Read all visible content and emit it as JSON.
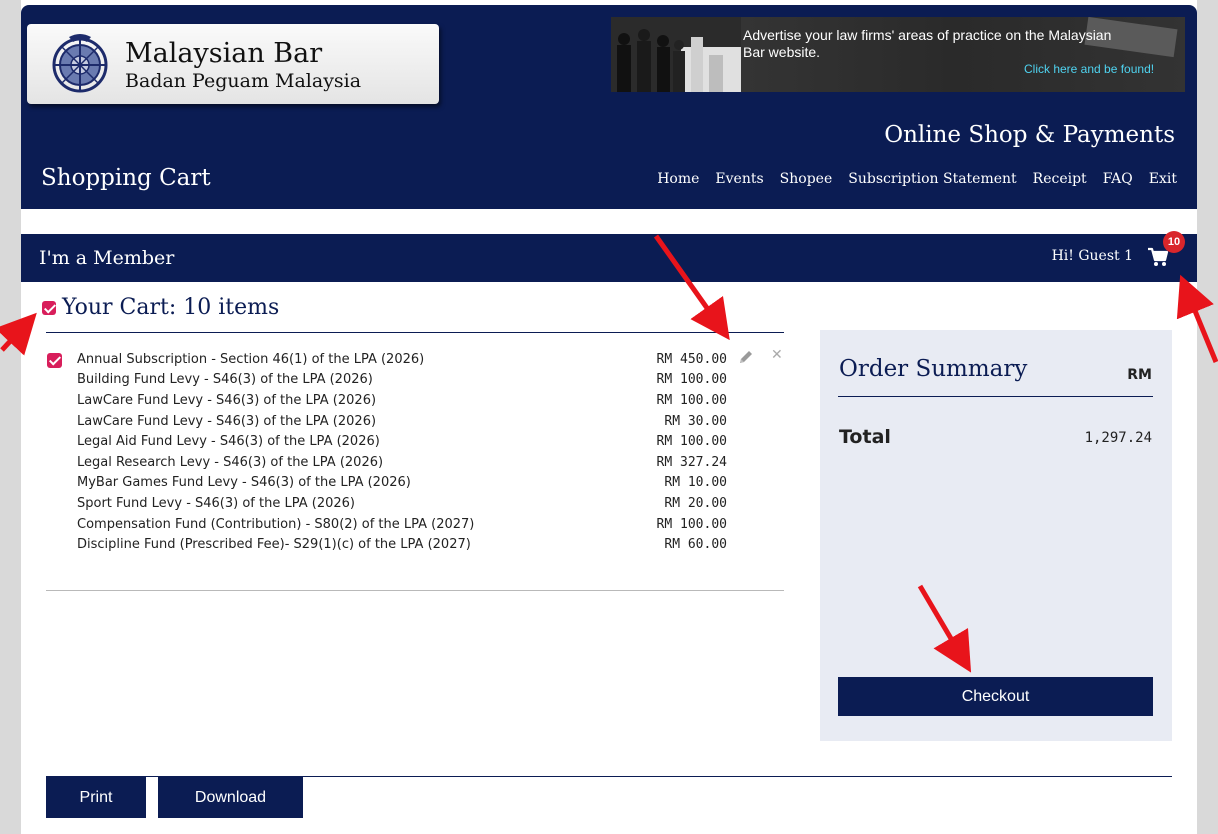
{
  "brand": {
    "title": "Malaysian Bar",
    "subtitle": "Badan Peguam Malaysia"
  },
  "ad": {
    "text": "Advertise your law firms' areas of practice on the Malaysian Bar website.",
    "link": "Click here and be found!"
  },
  "header": {
    "shop_title": "Online Shop & Payments",
    "page_heading": "Shopping Cart",
    "nav": [
      "Home",
      "Events",
      "Shopee",
      "Subscription Statement",
      "Receipt",
      "FAQ",
      "Exit"
    ]
  },
  "member_bar": {
    "title": "I'm a Member",
    "greeting": "Hi! Guest 1",
    "cart_count": "10"
  },
  "cart": {
    "heading": "Your Cart: 10 items",
    "items": [
      {
        "name": "Annual Subscription - Section 46(1) of the LPA (2026)",
        "price": "RM 450.00"
      },
      {
        "name": "Building Fund Levy - S46(3) of the LPA (2026)",
        "price": "RM 100.00"
      },
      {
        "name": "LawCare Fund Levy - S46(3) of the LPA (2026)",
        "price": "RM 100.00"
      },
      {
        "name": "LawCare Fund Levy - S46(3) of the LPA (2026)",
        "price": "RM 30.00"
      },
      {
        "name": "Legal Aid Fund Levy - S46(3) of the LPA (2026)",
        "price": "RM 100.00"
      },
      {
        "name": "Legal Research Levy - S46(3) of the LPA (2026)",
        "price": "RM 327.24"
      },
      {
        "name": "MyBar Games Fund Levy - S46(3) of the LPA (2026)",
        "price": "RM 10.00"
      },
      {
        "name": "Sport Fund Levy - S46(3) of the LPA (2026)",
        "price": "RM 20.00"
      },
      {
        "name": "Compensation Fund (Contribution) - S80(2) of the LPA (2027)",
        "price": "RM 100.00"
      },
      {
        "name": "Discipline Fund (Prescribed Fee)- S29(1)(c) of the LPA (2027)",
        "price": "RM 60.00"
      }
    ],
    "remove_glyph": "✕"
  },
  "summary": {
    "title": "Order Summary",
    "currency": "RM",
    "total_label": "Total",
    "total_value": "1,297.24",
    "checkout_label": "Checkout"
  },
  "actions": {
    "print_label": "Print",
    "download_label": "Download"
  },
  "colors": {
    "navy": "#0b1c53",
    "checkbox": "#d81e5b",
    "badge": "#d9262b",
    "annotation_arrow": "#e8141b"
  }
}
